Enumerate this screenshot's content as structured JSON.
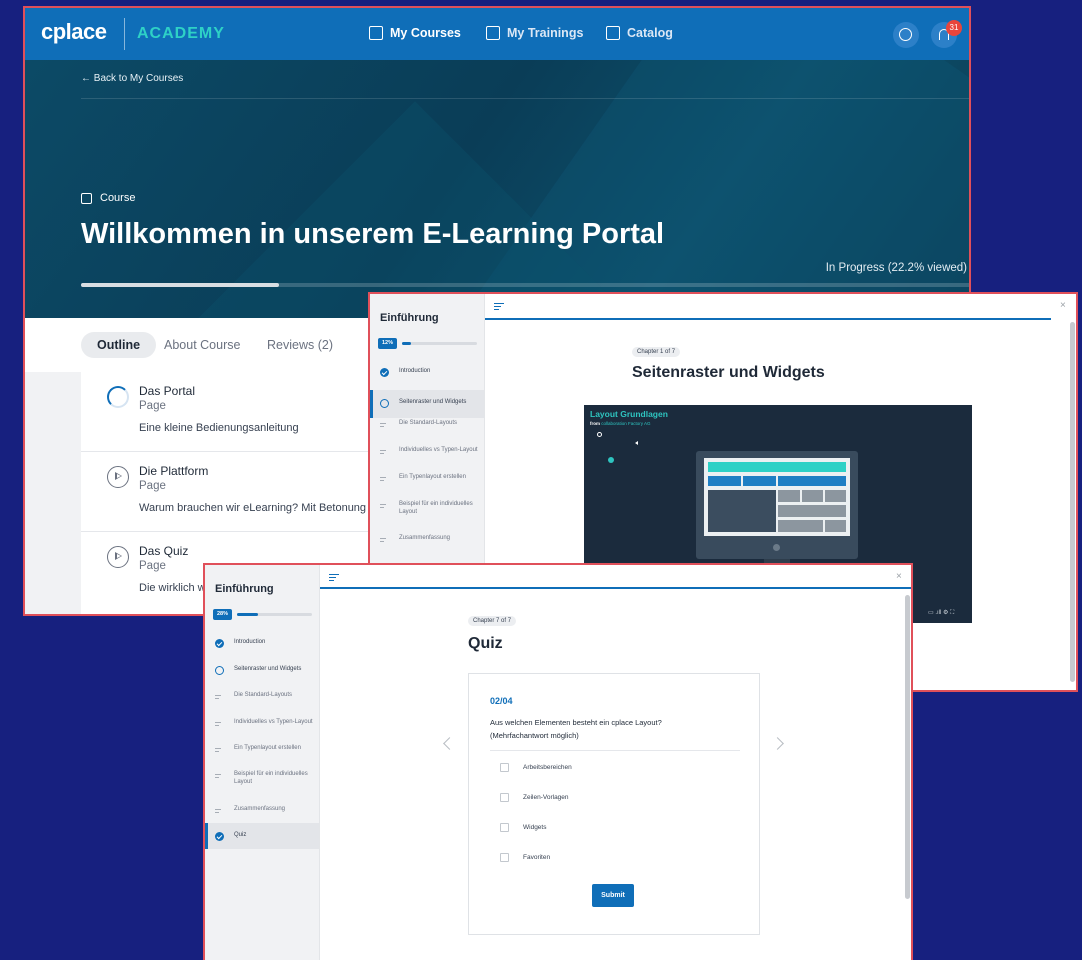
{
  "course_page": {
    "logo": "cplace",
    "brand_sub": "ACADEMY",
    "nav": [
      "My Courses",
      "My Trainings",
      "Catalog"
    ],
    "notification_count": "31",
    "back_link": "←  Back to My Courses",
    "course_tag": "Course",
    "title": "Willkommen in unserem E-Learning Portal",
    "status": "In Progress (22.2% viewed)",
    "progress": 0.222,
    "tabs": [
      "Outline",
      "About Course",
      "Reviews (2)"
    ],
    "lessons": [
      {
        "title": "Das Portal",
        "kind": "Page",
        "desc": "Eine kleine Bedienungsanleitung"
      },
      {
        "title": "Die Plattform",
        "kind": "Page",
        "desc": "Warum brauchen wir eLearning? Mit Betonung auf w"
      },
      {
        "title": "Das Quiz",
        "kind": "Page",
        "desc": "Die wirklich wi"
      }
    ]
  },
  "video_lesson": {
    "sidebar_title": "Einführung",
    "percent": "12%",
    "progress": 0.12,
    "items": [
      "Introduction",
      "Seitenraster und Widgets",
      "Die Standard-Layouts",
      "Individuelles vs Typen-Layout",
      "Ein Typenlayout erstellen",
      "Beispiel für ein individuelles Layout",
      "Zusammenfassung"
    ],
    "chapter": "Chapter 1 of 7",
    "heading": "Seitenraster und Widgets",
    "video_title": "Layout Grundlagen",
    "video_from": "from",
    "video_author": "collaboration Factory AG",
    "close": "×"
  },
  "quiz": {
    "sidebar_title": "Einführung",
    "percent": "28%",
    "progress": 0.28,
    "items": [
      "Introduction",
      "Seitenraster und Widgets",
      "Die Standard-Layouts",
      "Individuelles vs Typen-Layout",
      "Ein Typenlayout erstellen",
      "Beispiel für ein individuelles Layout",
      "Zusammenfassung",
      "Quiz"
    ],
    "chapter": "Chapter 7 of 7",
    "heading": "Quiz",
    "question_number": "02/04",
    "question_line1": "Aus welchen Elementen besteht ein cplace Layout?",
    "question_line2": "(Mehrfachantwort möglich)",
    "options": [
      "Arbeitsbereichen",
      "Zeilen-Vorlagen",
      "Widgets",
      "Favoriten"
    ],
    "submit": "Submit",
    "close": "×"
  },
  "colors": {
    "background": "#17207f",
    "brand_blue": "#0f6eb8",
    "accent_teal": "#2ed1c6",
    "frame_red": "#e0505a"
  },
  "icons": [
    "my-courses-icon",
    "my-trainings-icon",
    "catalog-icon",
    "chat-icon",
    "bell-icon",
    "menu-icon",
    "check-icon",
    "ring-icon",
    "play-icon"
  ]
}
